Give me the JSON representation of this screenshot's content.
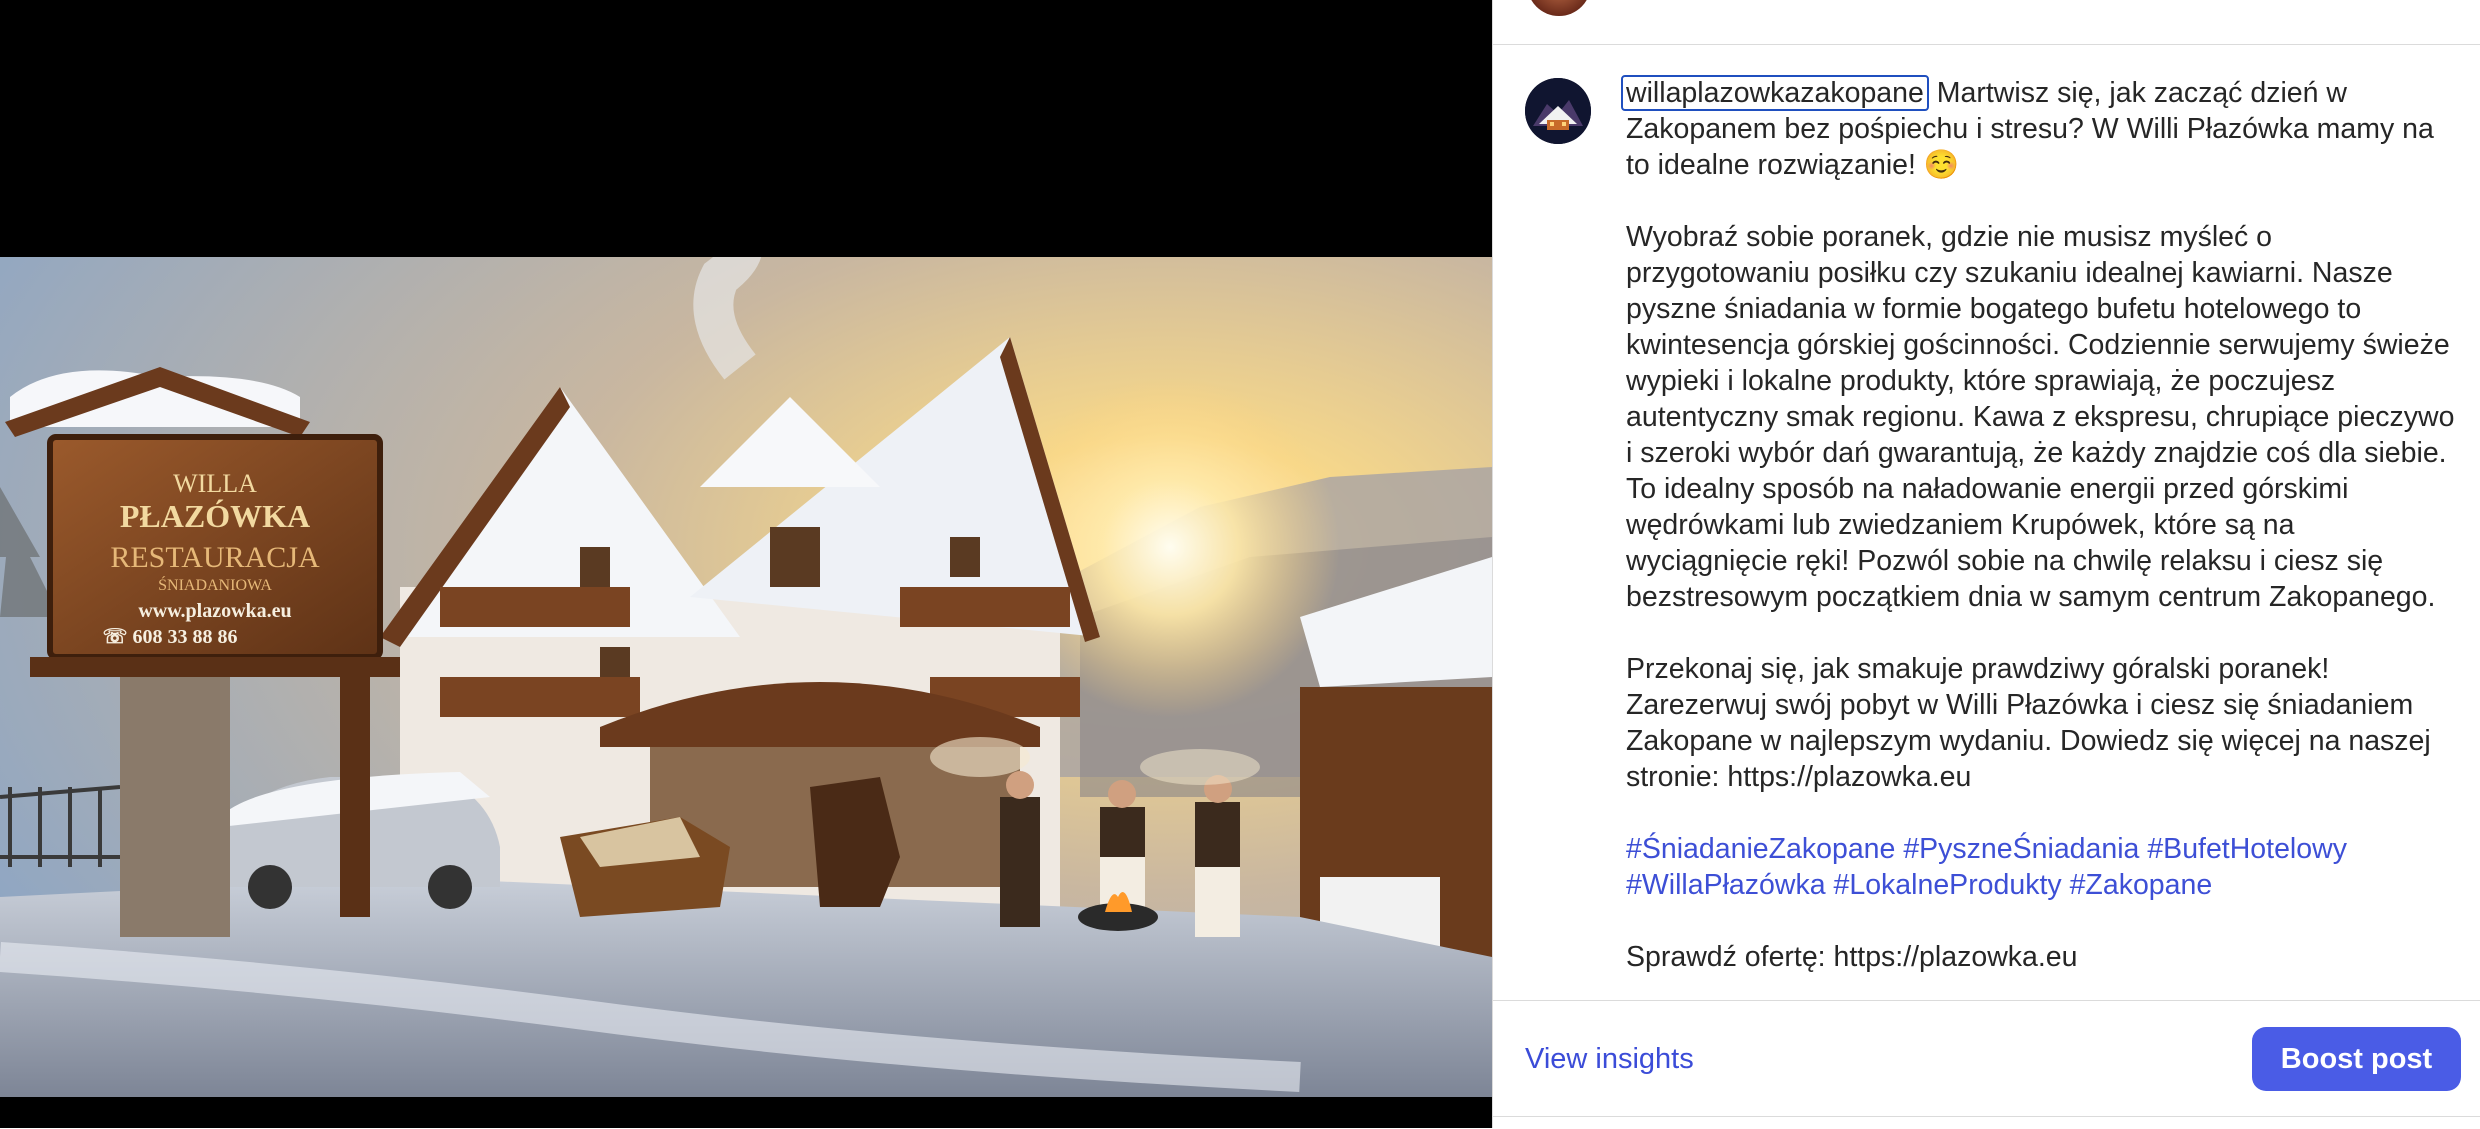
{
  "post": {
    "username": "willaplazowkazakopane",
    "caption_lead": "Martwisz się, jak zacząć dzień w Zakopanem bez pośpiechu i stresu? W Willi Płazówka mamy na to idealne rozwiązanie! ☺️",
    "paragraph_2": "Wyobraź sobie poranek, gdzie nie musisz myśleć o przygotowaniu posiłku czy szukaniu idealnej kawiarni. Nasze pyszne śniadania w formie bogatego bufetu hotelowego to kwintesencja górskiej gościnności. Codziennie serwujemy świeże wypieki i lokalne produkty, które sprawiają, że poczujesz autentyczny smak regionu. Kawa z ekspresu, chrupiące pieczywo i szeroki wybór dań gwarantują, że każdy znajdzie coś dla siebie. To idealny sposób na naładowanie energii przed górskimi wędrówkami lub zwiedzaniem Krupówek, które są na wyciągnięcie ręki! Pozwól sobie na chwilę relaksu i ciesz się bezstresowym początkiem dnia w samym centrum Zakopanego.",
    "paragraph_3": "Przekonaj się, jak smakuje prawdziwy góralski poranek! Zarezerwuj swój pobyt w Willi Płazówka i ciesz się śniadaniem Zakopane w najlepszym wydaniu. Dowiedz się więcej na naszej stronie: https://plazowka.eu",
    "hashtags": [
      "#ŚniadanieZakopane",
      "#PyszneŚniadania",
      "#BufetHotelowy",
      "#WillaPłazówka",
      "#LokalneProdukty",
      "#Zakopane"
    ],
    "cutoff_line": "Sprawdź ofertę: https://plazowka.eu"
  },
  "photo": {
    "sign_line1": "WILLA",
    "sign_line2": "PŁAZÓWKA",
    "sign_line3": "RESTAURACJA",
    "sign_line4": "ŚNIADANIOWA",
    "sign_line5": "www.plazowka.eu",
    "sign_line6": "☏ 608 33 88 86"
  },
  "footer": {
    "insights_label": "View insights",
    "boost_label": "Boost post"
  },
  "colors": {
    "accent": "#4a5ce6",
    "link": "#3b4cd8",
    "hashtag": "#3d4fd6"
  }
}
